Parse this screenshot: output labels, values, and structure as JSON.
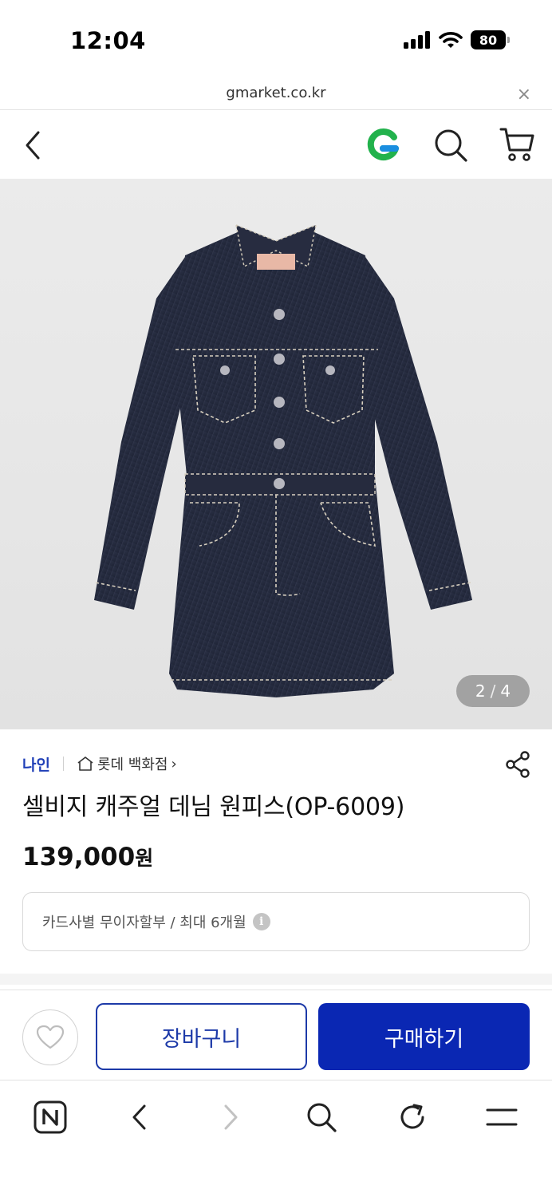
{
  "status_bar": {
    "time": "12:04",
    "battery": "80"
  },
  "url_bar": {
    "domain": "gmarket.co.kr",
    "close_symbol": "×"
  },
  "header": {
    "logo_letter": "G",
    "logo_color": "#22b24c"
  },
  "gallery": {
    "current": "2",
    "separator": "/",
    "total": "4"
  },
  "product": {
    "brand": "나인",
    "store": "롯데 백화점",
    "store_chevron": "›",
    "title": "셀비지 캐주얼 데님 원피스(OP-6009)",
    "price": "139,000",
    "price_unit": "원",
    "installment": "카드사별 무이자할부 / 최대 6개월",
    "info_symbol": "i"
  },
  "actions": {
    "cart_label": "장바구니",
    "buy_label": "구매하기"
  },
  "colors": {
    "brand_blue": "#1f3fb7",
    "primary": "#0a27b3",
    "denim": "#252b3f"
  }
}
